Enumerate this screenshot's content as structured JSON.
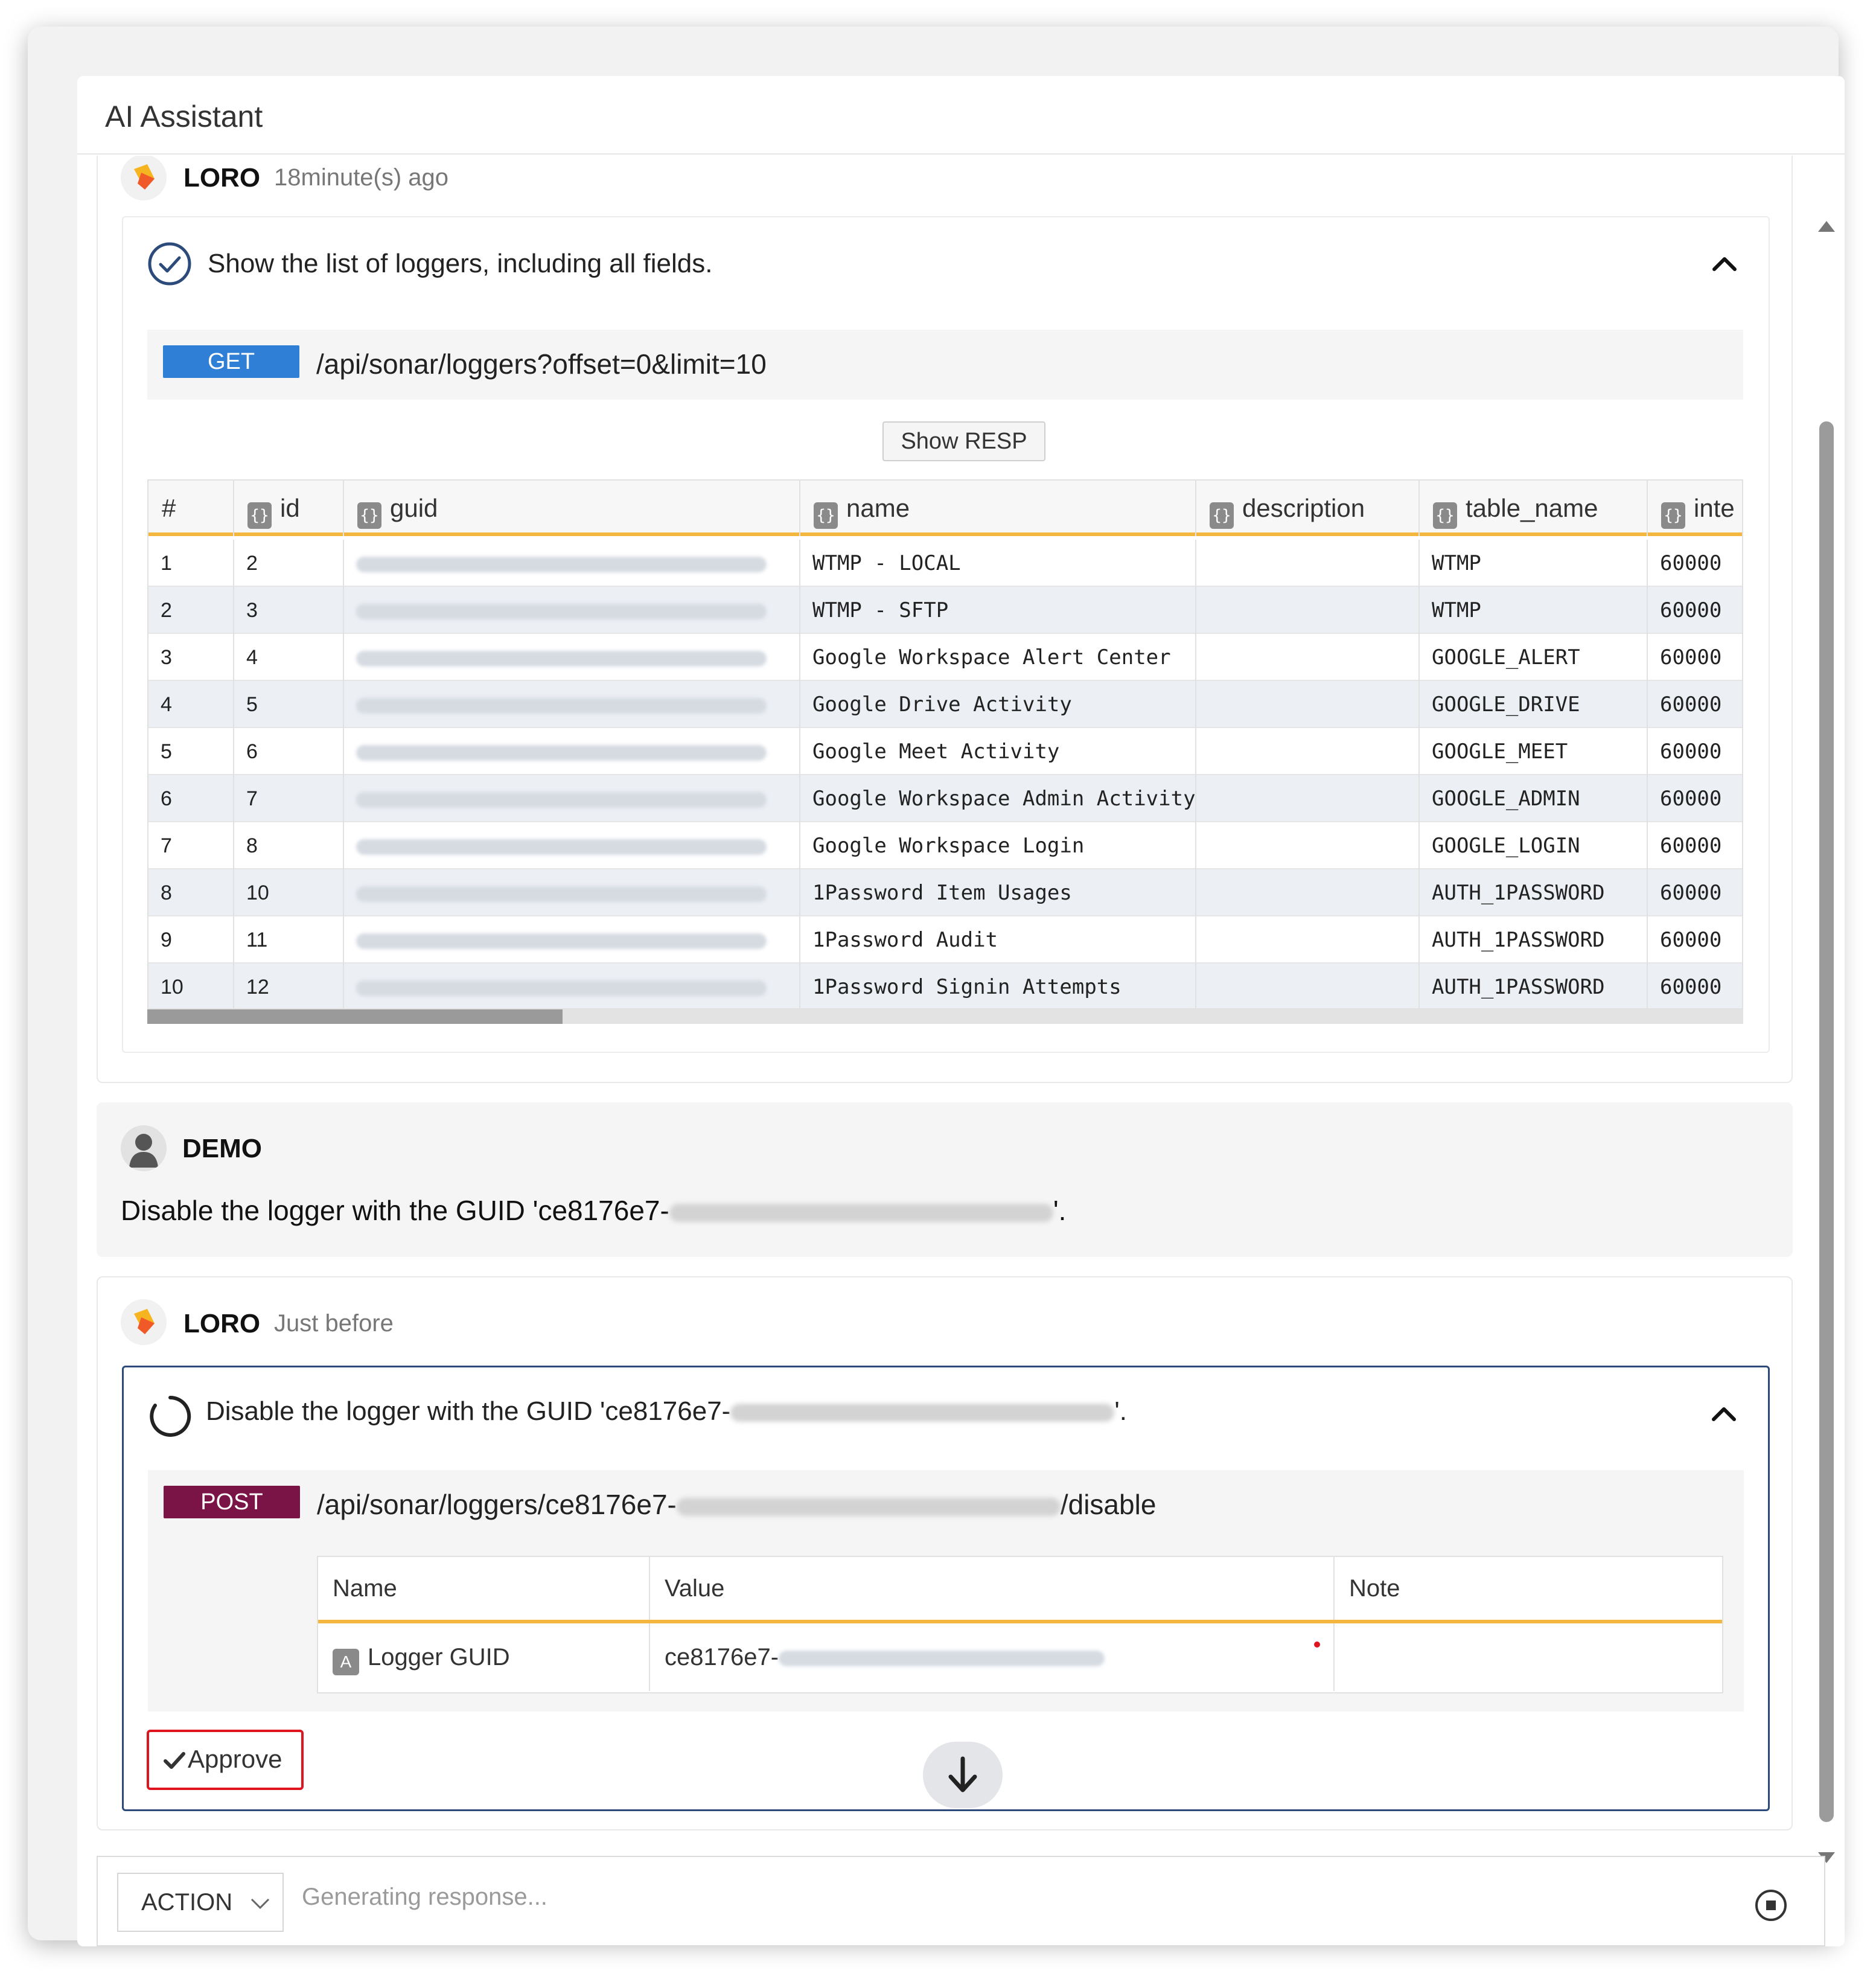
{
  "app": {
    "title": "AI Assistant"
  },
  "messages": {
    "first": {
      "sender": "LORO",
      "time": "18minute(s) ago",
      "tool": {
        "title": "Show the list of loggers, including all fields.",
        "method": "GET",
        "path": "/api/sonar/loggers?offset=0&limit=10",
        "show_resp_label": "Show RESP",
        "columns": [
          "#",
          "id",
          "guid",
          "name",
          "description",
          "table_name",
          "inte"
        ],
        "rows": [
          {
            "n": "1",
            "id": "2",
            "name": "WTMP - LOCAL",
            "description": "",
            "table_name": "WTMP",
            "inte": "60000"
          },
          {
            "n": "2",
            "id": "3",
            "name": "WTMP - SFTP",
            "description": "",
            "table_name": "WTMP",
            "inte": "60000"
          },
          {
            "n": "3",
            "id": "4",
            "name": "Google Workspace Alert Center",
            "description": "",
            "table_name": "GOOGLE_ALERT",
            "inte": "60000"
          },
          {
            "n": "4",
            "id": "5",
            "name": "Google Drive Activity",
            "description": "",
            "table_name": "GOOGLE_DRIVE",
            "inte": "60000"
          },
          {
            "n": "5",
            "id": "6",
            "name": "Google Meet Activity",
            "description": "",
            "table_name": "GOOGLE_MEET",
            "inte": "60000"
          },
          {
            "n": "6",
            "id": "7",
            "name": "Google Workspace Admin Activity",
            "description": "",
            "table_name": "GOOGLE_ADMIN",
            "inte": "60000"
          },
          {
            "n": "7",
            "id": "8",
            "name": "Google Workspace Login",
            "description": "",
            "table_name": "GOOGLE_LOGIN",
            "inte": "60000"
          },
          {
            "n": "8",
            "id": "10",
            "name": "1Password Item Usages",
            "description": "",
            "table_name": "AUTH_1PASSWORD",
            "inte": "60000"
          },
          {
            "n": "9",
            "id": "11",
            "name": "1Password Audit",
            "description": "",
            "table_name": "AUTH_1PASSWORD",
            "inte": "60000"
          },
          {
            "n": "10",
            "id": "12",
            "name": "1Password Signin Attempts",
            "description": "",
            "table_name": "AUTH_1PASSWORD",
            "inte": "60000"
          }
        ]
      }
    },
    "user": {
      "sender": "DEMO",
      "text_prefix": "Disable the logger with the GUID 'ce8176e7-",
      "text_suffix": "'."
    },
    "second": {
      "sender": "LORO",
      "time": "Just before",
      "tool": {
        "title_prefix": "Disable the logger with the GUID 'ce8176e7-",
        "title_suffix": "'.",
        "method": "POST",
        "path_prefix": "/api/sonar/loggers/ce8176e7-",
        "path_suffix": "/disable",
        "param_headers": [
          "Name",
          "Value",
          "Note"
        ],
        "param_name": "Logger GUID",
        "param_value_prefix": "ce8176e7-",
        "param_note": "",
        "approve_label": "Approve"
      }
    }
  },
  "input": {
    "mode": "ACTION",
    "placeholder": "Generating response..."
  },
  "colors": {
    "get": "#2f7fd6",
    "post": "#7a1447",
    "accent_border": "#f3b63f",
    "approve_outline": "#e0141e"
  }
}
